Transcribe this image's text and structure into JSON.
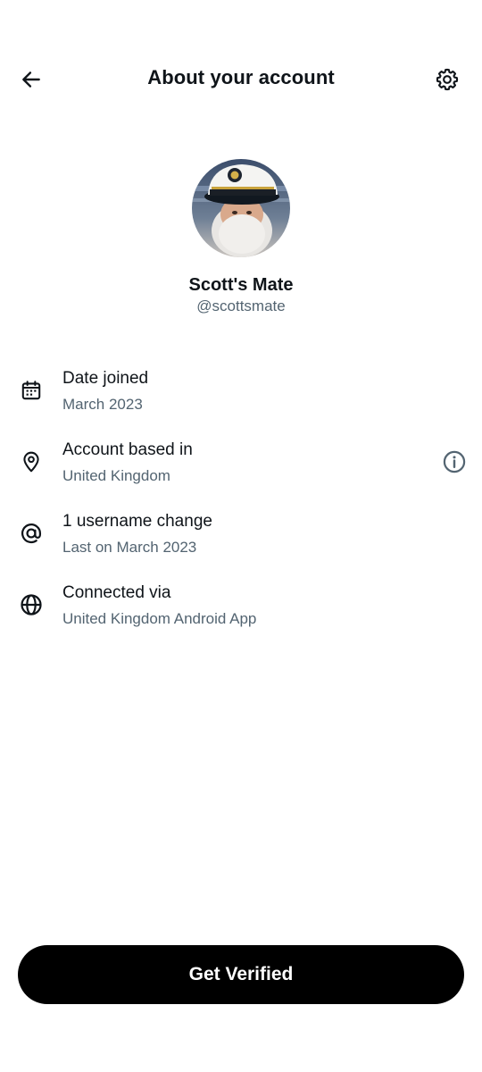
{
  "header": {
    "title": "About your account",
    "back_icon": "arrow-left-icon",
    "settings_icon": "gear-icon"
  },
  "profile": {
    "name": "Scott's Mate",
    "handle": "@scottsmate",
    "avatar_description_icon": "avatar"
  },
  "rows": [
    {
      "icon": "calendar-icon",
      "label": "Date joined",
      "value": "March 2023"
    },
    {
      "icon": "location-pin-icon",
      "label": "Account based in",
      "value": "United Kingdom",
      "info_icon": "info-icon"
    },
    {
      "icon": "at-sign-icon",
      "label": "1 username change",
      "value": "Last on March 2023"
    },
    {
      "icon": "globe-icon",
      "label": "Connected via",
      "value": "United Kingdom Android App"
    }
  ],
  "cta": {
    "label": "Get Verified"
  },
  "colors": {
    "text_primary": "#0f1419",
    "text_secondary": "#536471",
    "cta_background": "#000000",
    "cta_text": "#ffffff"
  }
}
